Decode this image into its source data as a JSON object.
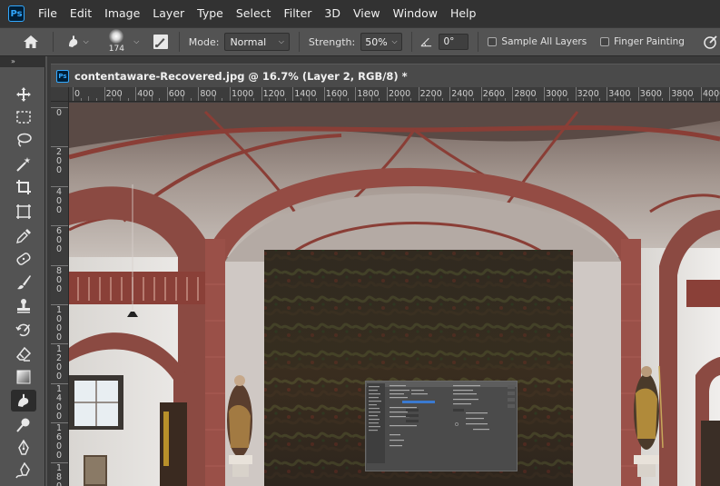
{
  "menu": {
    "logo": "Ps",
    "items": [
      "File",
      "Edit",
      "Image",
      "Layer",
      "Type",
      "Select",
      "Filter",
      "3D",
      "View",
      "Window",
      "Help"
    ]
  },
  "options": {
    "brush_size": "174",
    "mode_label": "Mode:",
    "mode_value": "Normal",
    "strength_label": "Strength:",
    "strength_value": "50%",
    "angle_value": "0°",
    "sample_all_layers": "Sample All Layers",
    "finger_painting": "Finger Painting",
    "sample_all_checked": false,
    "finger_painting_checked": false
  },
  "panel": {
    "collapse_glyph": "»"
  },
  "document": {
    "icon": "Ps",
    "title": "contentaware-Recovered.jpg @ 16.7% (Layer 2, RGB/8) *"
  },
  "ruler": {
    "h_ticks": [
      "0",
      "200",
      "400",
      "600",
      "800",
      "1000",
      "1200",
      "1400",
      "1600",
      "1800",
      "2000",
      "2200",
      "2400",
      "2600",
      "2800",
      "3000",
      "3200",
      "3400",
      "3600",
      "3800",
      "4000",
      "4200"
    ],
    "v_ticks": [
      "0",
      "200",
      "400",
      "600",
      "800",
      "1000",
      "1200",
      "1400",
      "1600",
      "1800"
    ]
  },
  "tools": [
    {
      "name": "move-tool",
      "icon": "move-icon"
    },
    {
      "name": "marquee-tool",
      "icon": "rect-marquee-icon"
    },
    {
      "name": "lasso-tool",
      "icon": "lasso-icon"
    },
    {
      "name": "magic-wand-tool",
      "icon": "magic-wand-icon"
    },
    {
      "name": "crop-tool",
      "icon": "crop-icon"
    },
    {
      "name": "frame-tool",
      "icon": "frame-icon"
    },
    {
      "name": "eyedropper-tool",
      "icon": "eyedropper-icon"
    },
    {
      "name": "healing-tool",
      "icon": "healing-icon"
    },
    {
      "name": "brush-tool",
      "icon": "brush-icon"
    },
    {
      "name": "stamp-tool",
      "icon": "stamp-icon"
    },
    {
      "name": "history-brush-tool",
      "icon": "history-brush-icon"
    },
    {
      "name": "eraser-tool",
      "icon": "eraser-icon"
    },
    {
      "name": "gradient-tool",
      "icon": "gradient-icon"
    },
    {
      "name": "smudge-tool",
      "icon": "smudge-icon"
    },
    {
      "name": "dodge-tool",
      "icon": "dodge-icon"
    },
    {
      "name": "pen-tool",
      "icon": "pen-icon"
    },
    {
      "name": "freeform-pen-tool",
      "icon": "freeform-pen-icon"
    }
  ],
  "active_tool": "smudge-tool",
  "colors": {
    "menubar": "#323232",
    "panel": "#535353",
    "accent": "#31a8ff"
  }
}
